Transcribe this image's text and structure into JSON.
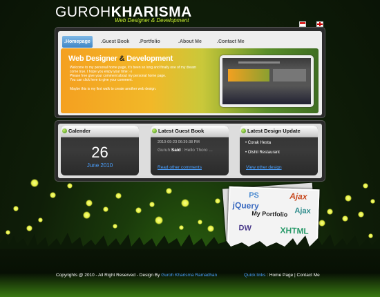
{
  "logo": {
    "name_first": "GUROH",
    "name_last": "KHARISMA",
    "tagline": "Web Designer & Development"
  },
  "nav": [
    "Homepage",
    "Guest Book",
    "Portfolio",
    "About Me",
    "Contact Me"
  ],
  "nav_prefix": ".",
  "banner": {
    "title_part1": "Web Designer ",
    "title_amp": "&",
    "title_part2": " Development",
    "lines": [
      "Welcome to my personal home page, it's been so long and finally one of my dream",
      "come true. I hope you enjoy your time :-)",
      "Please free give your comment about my personal home page.",
      "You can click here to give your comment."
    ],
    "footer_line": "Maybe this is my first walk to create another web design."
  },
  "widgets": {
    "calendar": {
      "title": "Calender",
      "day": "26",
      "month_year": "June 2010"
    },
    "guestbook": {
      "title": "Latest Guest Book",
      "timestamp": "2010-09-23 06:39:38 PM",
      "author": "Guruh",
      "said": "Said",
      "message": "Hello Thoro ...",
      "link": "Read other comments"
    },
    "design": {
      "title": "Latest Design Update",
      "items": [
        "Corak Hesta",
        "Olshil Restaurant"
      ],
      "link": "View other design"
    }
  },
  "portfolio_card": {
    "label": "My Portfolio",
    "tags": [
      "PS",
      "Ajax",
      "jQuery",
      "Ajax",
      "DW",
      "XHTML"
    ]
  },
  "footer": {
    "copyright": "Copyrights @ 2010 - All Right Reserved - Design By ",
    "designer": "Guroh Kharisma Ramadhan",
    "quick_label": "Quick links",
    "sep": " : ",
    "link_home": "Home Page",
    "pipe": " | ",
    "link_contact": "Contact Me"
  },
  "colors": {
    "accent_green": "#c9ef32",
    "link_blue": "#4aa0ff"
  }
}
